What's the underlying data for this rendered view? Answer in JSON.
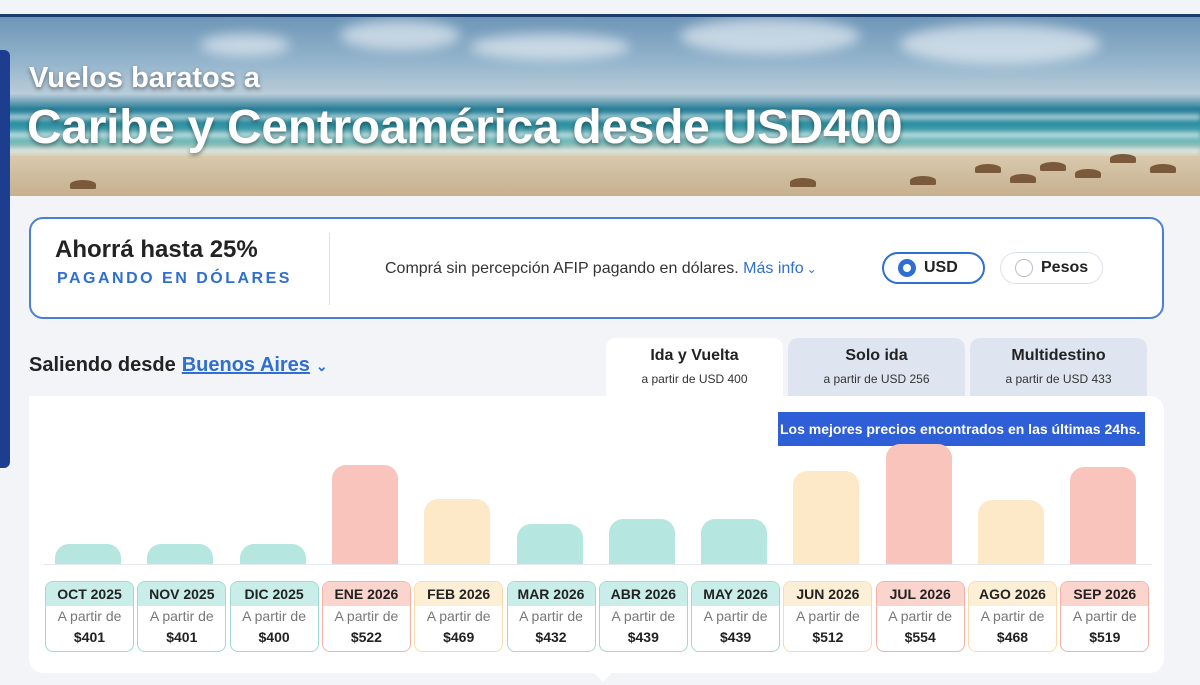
{
  "hero": {
    "subtitle": "Vuelos baratos a",
    "title": "Caribe y Centroamérica desde USD400"
  },
  "promo": {
    "title": "Ahorrá hasta 25%",
    "subtitle": "PAGANDO EN DÓLARES",
    "text": "Comprá sin percepción AFIP pagando en dólares.",
    "link": "Más info",
    "currency_options": [
      {
        "label": "USD",
        "selected": true
      },
      {
        "label": "Pesos",
        "selected": false
      }
    ]
  },
  "origin": {
    "label": "Saliendo desde",
    "city": "Buenos Aires"
  },
  "tabs": [
    {
      "label": "Ida y Vuelta",
      "price": "a partir de USD 400",
      "active": true
    },
    {
      "label": "Solo ida",
      "price": "a partir de USD 256",
      "active": false
    },
    {
      "label": "Multidestino",
      "price": "a partir de USD 433",
      "active": false
    }
  ],
  "banner": "Los mejores precios encontrados en las últimas 24hs.",
  "price_prefix": "A partir de",
  "colors": {
    "low": {
      "bar": "#b5e6e0",
      "head": "#c9ede8",
      "border": "#9fdad2"
    },
    "mid": {
      "bar": "#fde9c8",
      "head": "#fdeed6",
      "border": "#f7dcae"
    },
    "high": {
      "bar": "#f9c4bb",
      "head": "#fbd4cd",
      "border": "#f4b1a5"
    }
  },
  "chart_data": {
    "type": "bar",
    "categories": [
      "OCT 2025",
      "NOV 2025",
      "DIC 2025",
      "ENE 2026",
      "FEB 2026",
      "MAR 2026",
      "ABR 2026",
      "MAY 2026",
      "JUN 2026",
      "JUL 2026",
      "AGO 2026",
      "SEP 2026"
    ],
    "values": [
      401,
      401,
      400,
      522,
      469,
      432,
      439,
      439,
      512,
      554,
      468,
      519
    ],
    "prices": [
      "$401",
      "$401",
      "$400",
      "$522",
      "$469",
      "$432",
      "$439",
      "$439",
      "$512",
      "$554",
      "$468",
      "$519"
    ],
    "levels": [
      "low",
      "low",
      "low",
      "high",
      "mid",
      "low",
      "low",
      "low",
      "mid",
      "high",
      "mid",
      "high"
    ],
    "ylim": [
      370,
      560
    ]
  }
}
